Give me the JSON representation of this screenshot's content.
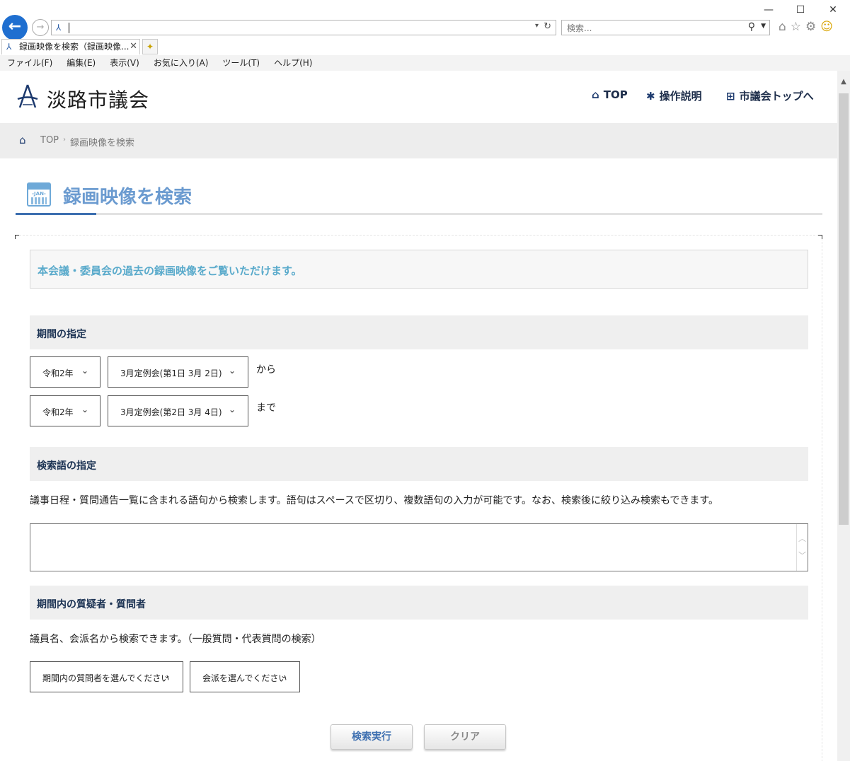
{
  "browser": {
    "window_controls": {
      "minimize": "—",
      "maximize": "☐",
      "close": "✕"
    },
    "address_value": "",
    "search_placeholder": "検索...",
    "tab_title": "録画映像を検索（録画映像...",
    "menu": [
      "ファイル(F)",
      "編集(E)",
      "表示(V)",
      "お気に入り(A)",
      "ツール(T)",
      "ヘルプ(H)"
    ]
  },
  "site": {
    "name": "淡路市議会",
    "nav": [
      {
        "icon": "home-icon",
        "label": "TOP"
      },
      {
        "icon": "gear-icon",
        "label": "操作説明"
      },
      {
        "icon": "sitemap-icon",
        "label": "市議会トップへ"
      }
    ]
  },
  "breadcrumb": {
    "home": "TOP",
    "current": "録画映像を検索"
  },
  "page": {
    "title": "録画映像を検索",
    "calendar_label": "-JAN-",
    "intro": "本会議・委員会の過去の録画映像をご覧いただけます。"
  },
  "period": {
    "heading": "期間の指定",
    "from": {
      "year": "令和2年",
      "session": "3月定例会(第1日 3月 2日)",
      "suffix": "から"
    },
    "to": {
      "year": "令和2年",
      "session": "3月定例会(第2日 3月 4日)",
      "suffix": "まで"
    }
  },
  "keyword": {
    "heading": "検索語の指定",
    "description": "議事日程・質問通告一覧に含まれる語句から検索します。語句はスペースで区切り、複数語句の入力が可能です。なお、検索後に絞り込み検索もできます。",
    "value": ""
  },
  "questioner": {
    "heading": "期間内の質疑者・質問者",
    "description": "議員名、会派名から検索できます。（一般質問・代表質問の検索）",
    "member_select": "期間内の質問者を選んでください",
    "faction_select": "会派を選んでください"
  },
  "actions": {
    "search": "検索実行",
    "clear": "クリア"
  },
  "colors": {
    "accent": "#3d6fb0",
    "title": "#6b9bd0",
    "intro_text": "#59aacb",
    "section_text": "#1a3152"
  }
}
